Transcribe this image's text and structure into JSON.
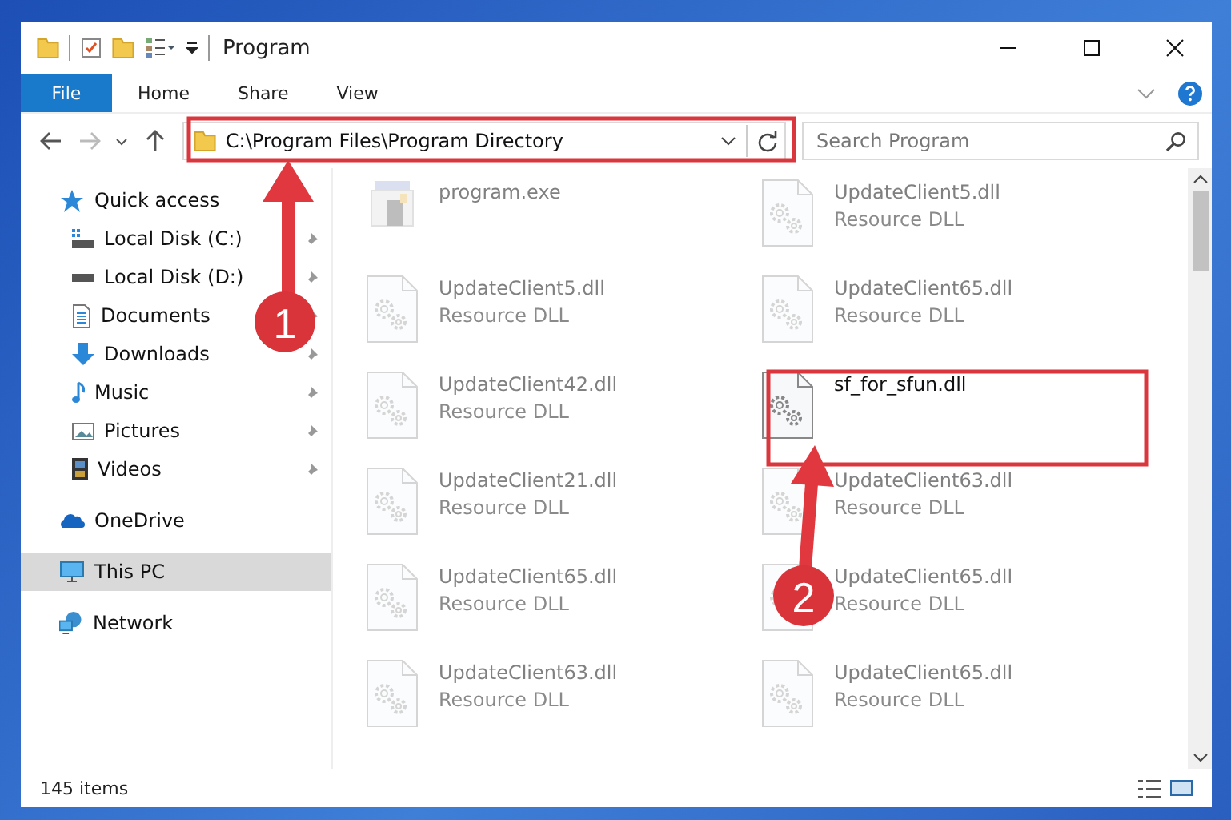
{
  "window": {
    "title": "Program"
  },
  "ribbon": {
    "file_tab": "File",
    "tabs": [
      "Home",
      "Share",
      "View"
    ]
  },
  "address": {
    "path": "C:\\Program Files\\Program Directory"
  },
  "search": {
    "placeholder": "Search Program"
  },
  "sidebar": {
    "items": [
      {
        "label": "Quick access",
        "kind": "star",
        "selected": false,
        "children": [
          {
            "label": "Local Disk (C:)",
            "kind": "drive-c",
            "pinned": true
          },
          {
            "label": "Local Disk (D:)",
            "kind": "drive",
            "pinned": true
          },
          {
            "label": "Documents",
            "kind": "documents",
            "pinned": true
          },
          {
            "label": "Downloads",
            "kind": "downloads",
            "pinned": true
          },
          {
            "label": "Music",
            "kind": "music",
            "pinned": true
          },
          {
            "label": "Pictures",
            "kind": "pictures",
            "pinned": true
          },
          {
            "label": "Videos",
            "kind": "videos",
            "pinned": true
          }
        ]
      },
      {
        "label": "OneDrive",
        "kind": "cloud",
        "selected": false
      },
      {
        "label": "This PC",
        "kind": "pc",
        "selected": true
      },
      {
        "label": "Network",
        "kind": "network",
        "selected": false
      }
    ]
  },
  "files": [
    {
      "name": "program.exe",
      "kind": "exe",
      "blurred": true
    },
    {
      "name": "UpdateClient5.dll",
      "type": "Resource DLL",
      "kind": "dll",
      "blurred": true
    },
    {
      "name": "UpdateClient5.dll",
      "type": "Resource DLL",
      "kind": "dll",
      "blurred": true
    },
    {
      "name": "UpdateClient65.dll",
      "type": "Resource DLL",
      "kind": "dll",
      "blurred": true
    },
    {
      "name": "UpdateClient42.dll",
      "type": "Resource DLL",
      "kind": "dll",
      "blurred": true
    },
    {
      "name": "sf_for_sfun.dll",
      "kind": "dll",
      "blurred": false
    },
    {
      "name": "UpdateClient21.dll",
      "type": "Resource DLL",
      "kind": "dll",
      "blurred": true
    },
    {
      "name": "UpdateClient63.dll",
      "type": "Resource DLL",
      "kind": "dll",
      "blurred": true
    },
    {
      "name": "UpdateClient65.dll",
      "type": "Resource DLL",
      "kind": "dll",
      "blurred": true
    },
    {
      "name": "UpdateClient65.dll",
      "type": "Resource DLL",
      "kind": "dll",
      "blurred": true
    },
    {
      "name": "UpdateClient63.dll",
      "type": "Resource DLL",
      "kind": "dll",
      "blurred": true
    },
    {
      "name": "UpdateClient65.dll",
      "type": "Resource DLL",
      "kind": "dll",
      "blurred": true
    }
  ],
  "status_bar": {
    "count": "145 items"
  },
  "callouts": [
    {
      "number": "1"
    },
    {
      "number": "2"
    }
  ]
}
